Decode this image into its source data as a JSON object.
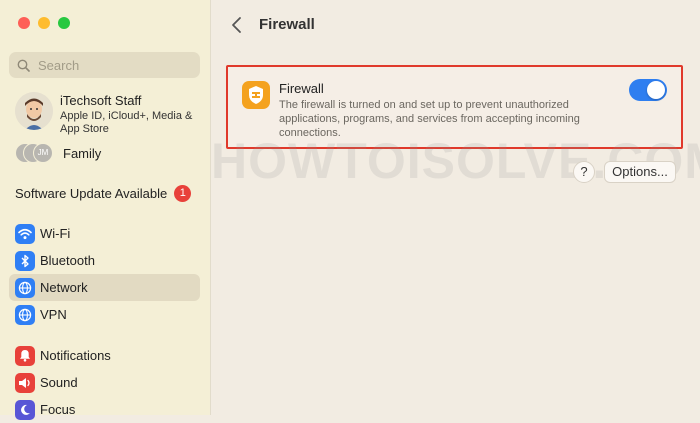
{
  "search": {
    "placeholder": "Search"
  },
  "account": {
    "name": "iTechsoft Staff",
    "subtitle": "Apple ID, iCloud+, Media & App Store"
  },
  "family": {
    "label": "Family",
    "initials": "JM"
  },
  "update": {
    "label": "Software Update Available",
    "badge": "1"
  },
  "nav": [
    {
      "label": "Wi-Fi",
      "icon": "wifi-icon",
      "color": "#2f7ff5"
    },
    {
      "label": "Bluetooth",
      "icon": "bluetooth-icon",
      "color": "#2f7ff5"
    },
    {
      "label": "Network",
      "icon": "globe-icon",
      "color": "#2f7ff5",
      "active": true
    },
    {
      "label": "VPN",
      "icon": "globe-icon",
      "color": "#2f7ff5"
    },
    {
      "label": "Notifications",
      "icon": "bell-icon",
      "color": "#e8413a"
    },
    {
      "label": "Sound",
      "icon": "speaker-icon",
      "color": "#e8413a"
    },
    {
      "label": "Focus",
      "icon": "moon-icon",
      "color": "#5856d6"
    }
  ],
  "main": {
    "title": "Firewall",
    "firewall": {
      "title": "Firewall",
      "description": "The firewall is turned on and set up to prevent unauthorized applications, programs, and services from accepting incoming connections.",
      "enabled": true,
      "icon": "shield-icon",
      "icon_color": "#f4a21f"
    },
    "help_label": "?",
    "options_label": "Options..."
  },
  "watermark": "HOWTOISOLVE.COM",
  "colors": {
    "accent": "#2e7ef0",
    "highlight_border": "#e0392b"
  }
}
